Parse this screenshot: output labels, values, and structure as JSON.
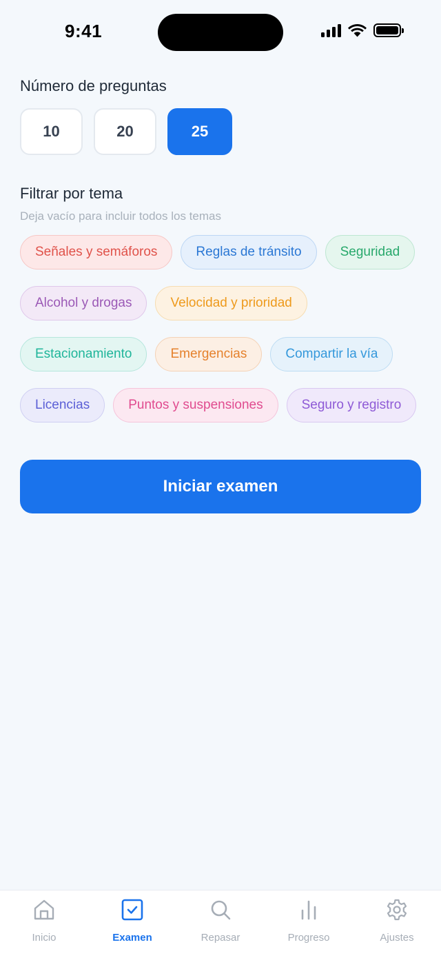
{
  "status_bar": {
    "time": "9:41"
  },
  "questions": {
    "title": "Número de preguntas",
    "options": [
      "10",
      "20",
      "25"
    ],
    "selected": "25"
  },
  "filter": {
    "title": "Filtrar por tema",
    "hint": "Deja vacío para incluir todos los temas",
    "chips": [
      {
        "label": "Señales y semáforos",
        "color": "#e0524a",
        "bg": "#fde8e8",
        "border": "#f6c7c5"
      },
      {
        "label": "Reglas de tránsito",
        "color": "#2a77d4",
        "bg": "#e6f0fc",
        "border": "#bcd6f4"
      },
      {
        "label": "Seguridad",
        "color": "#27a86b",
        "bg": "#e5f6ee",
        "border": "#bde6d1"
      },
      {
        "label": "Alcohol y drogas",
        "color": "#9b59b6",
        "bg": "#f3e9f7",
        "border": "#dfc7ea"
      },
      {
        "label": "Velocidad y prioridad",
        "color": "#ee9a1c",
        "bg": "#fdf2e2",
        "border": "#f6dcb0"
      },
      {
        "label": "Estacionamiento",
        "color": "#1fb59a",
        "bg": "#e3f6f2",
        "border": "#b5e6dc"
      },
      {
        "label": "Emergencias",
        "color": "#e5812c",
        "bg": "#fcefe4",
        "border": "#f4d2b6"
      },
      {
        "label": "Compartir la vía",
        "color": "#3498db",
        "bg": "#e6f2fb",
        "border": "#bddcf3"
      },
      {
        "label": "Licencias",
        "color": "#5b5fd6",
        "bg": "#ebebfb",
        "border": "#cfcff2"
      },
      {
        "label": "Puntos y suspensiones",
        "color": "#e04b8f",
        "bg": "#fce8f1",
        "border": "#f5c4da"
      },
      {
        "label": "Seguro y registro",
        "color": "#8e5ad6",
        "bg": "#f0e9fb",
        "border": "#d9c8f1"
      }
    ]
  },
  "start_button": {
    "label": "Iniciar examen"
  },
  "tabs": [
    {
      "label": "Inicio",
      "icon": "home-icon",
      "active": false
    },
    {
      "label": "Examen",
      "icon": "checkbox-icon",
      "active": true
    },
    {
      "label": "Repasar",
      "icon": "search-icon",
      "active": false
    },
    {
      "label": "Progreso",
      "icon": "bar-chart-icon",
      "active": false
    },
    {
      "label": "Ajustes",
      "icon": "gear-icon",
      "active": false
    }
  ],
  "colors": {
    "accent": "#1a73ec",
    "inactive_tab": "#a6adb6",
    "background": "#f4f8fc"
  }
}
